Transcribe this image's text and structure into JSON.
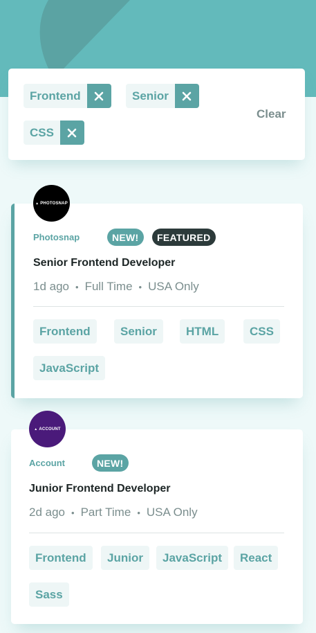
{
  "colors": {
    "primary": "#5ba4a4",
    "hero_background": "#63babb",
    "page_background": "#eef9f9",
    "tag_background": "#eef6f6",
    "featured_badge": "#2c3a3a",
    "muted_text": "#7b8e8e"
  },
  "filters": {
    "chips": [
      {
        "label": "Frontend",
        "remove_icon": "close-icon"
      },
      {
        "label": "Senior",
        "remove_icon": "close-icon"
      },
      {
        "label": "CSS",
        "remove_icon": "close-icon"
      }
    ],
    "clear_label": "Clear"
  },
  "jobs": [
    {
      "company": "Photosnap",
      "logo_text": "PHOTOSNAP",
      "logo_color": "#000000",
      "badges": {
        "new": "NEW!",
        "featured": "FEATURED"
      },
      "position": "Senior Frontend Developer",
      "posted": "1d ago",
      "contract": "Full Time",
      "location": "USA Only",
      "tags": [
        "Frontend",
        "Senior",
        "HTML",
        "CSS",
        "JavaScript"
      ],
      "featured": true
    },
    {
      "company": "Account",
      "logo_text": "ACCOUNT",
      "logo_color": "#4a1a7a",
      "badges": {
        "new": "NEW!"
      },
      "position": "Junior Frontend Developer",
      "posted": "2d ago",
      "contract": "Part Time",
      "location": "USA Only",
      "tags": [
        "Frontend",
        "Junior",
        "JavaScript",
        "React",
        "Sass"
      ],
      "featured": false
    }
  ]
}
